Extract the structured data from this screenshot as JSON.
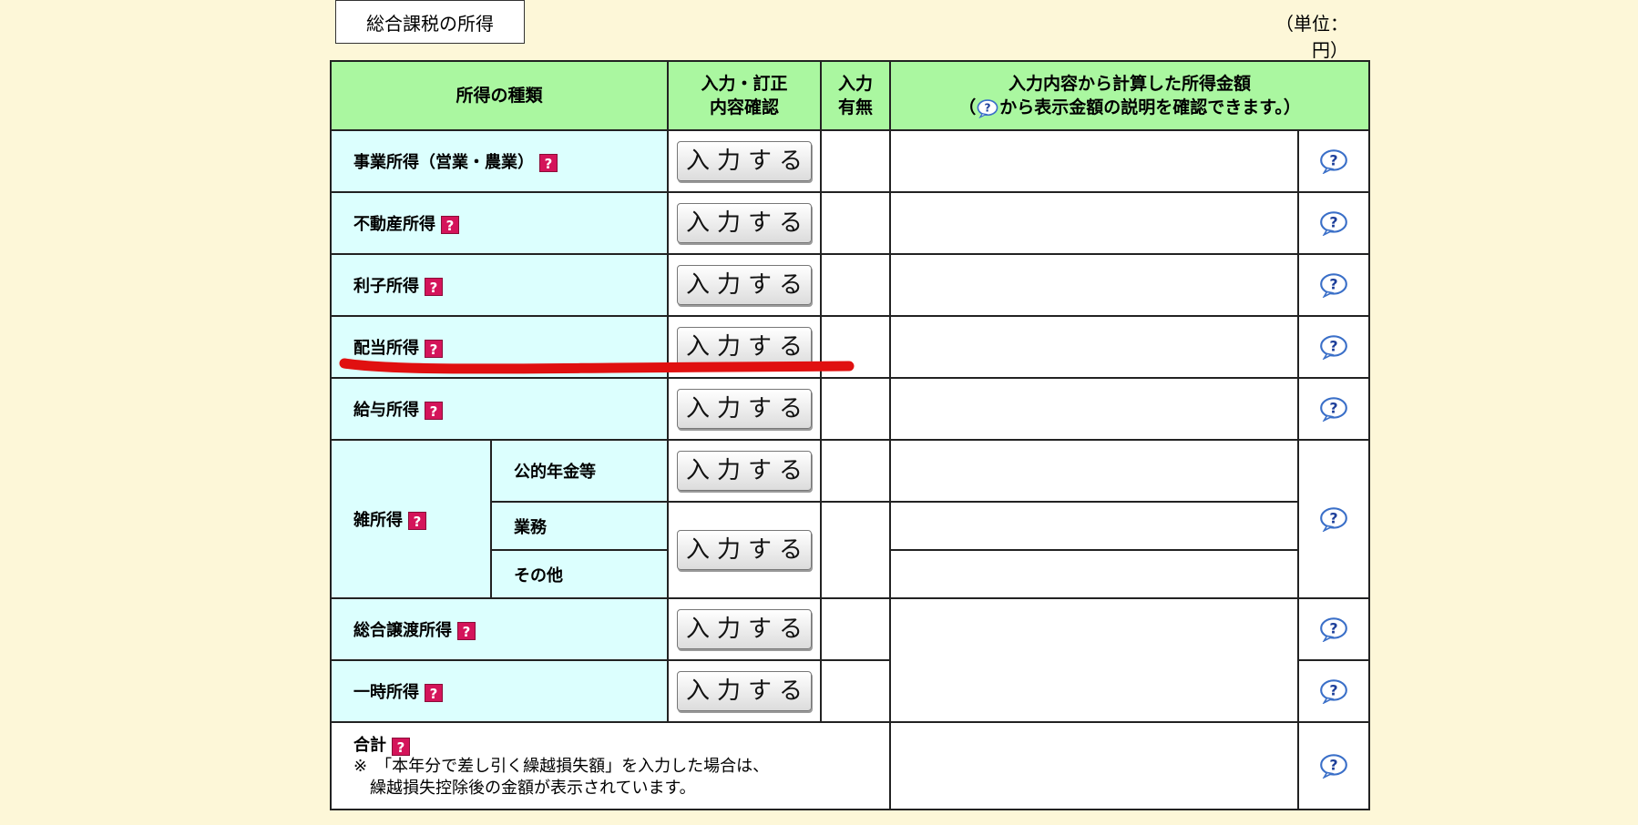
{
  "section_title": "総合課税の所得",
  "unit": "（単位：円）",
  "header": {
    "type": "所得の種類",
    "input_line1": "入力・訂正",
    "input_line2": "内容確認",
    "has_line1": "入力",
    "has_line2": "有無",
    "calc_line1": "入力内容から計算した所得金額",
    "calc_pre": "（",
    "calc_post": "から表示金額の説明を確認できます。）"
  },
  "button_label": "入力する",
  "help_mark": "?",
  "rows": {
    "business": "事業所得（営業・農業）",
    "real_estate": "不動産所得",
    "interest": "利子所得",
    "dividend": "配当所得",
    "salary": "給与所得",
    "misc": "雑所得",
    "misc_pension": "公的年金等",
    "misc_business": "業務",
    "misc_other": "その他",
    "transfer": "総合譲渡所得",
    "temporary": "一時所得",
    "total": "合計",
    "total_note1": "※　「本年分で差し引く繰越損失額」を入力した場合は、",
    "total_note2": "　繰越損失控除後の金額が表示されています。"
  },
  "colors": {
    "page_bg": "#fdf7d8",
    "header_bg": "#aaf7a0",
    "label_bg": "#dcfffe",
    "help_icon": "#d4145a",
    "highlight_mark": "#e01010"
  }
}
